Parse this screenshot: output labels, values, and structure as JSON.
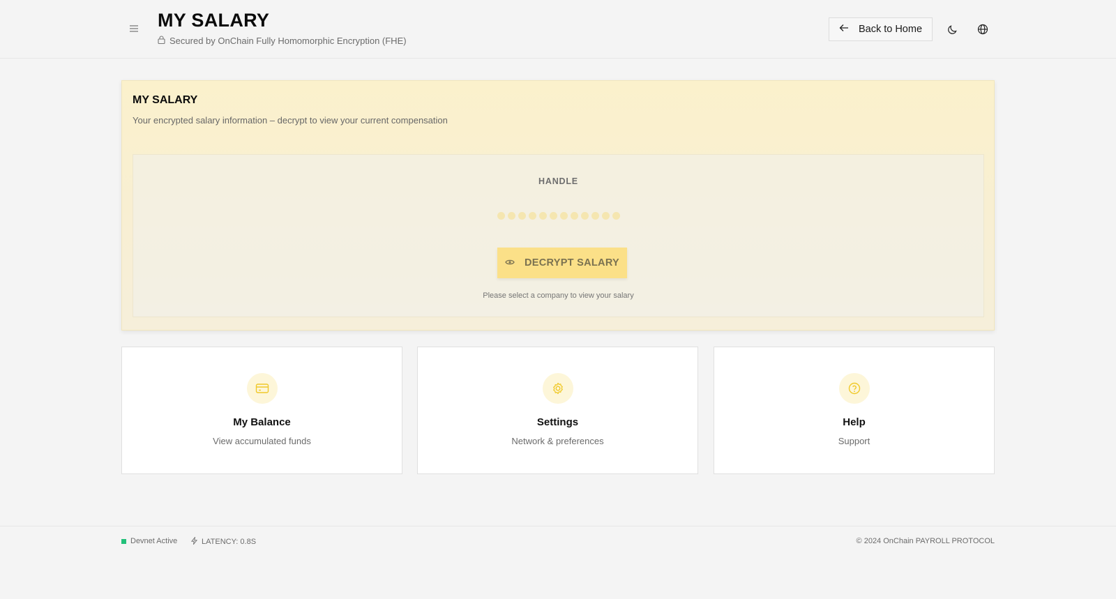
{
  "header": {
    "title": "MY SALARY",
    "subtitle": "Secured by OnChain Fully Homomorphic Encryption (FHE)",
    "back_label": "Back to Home",
    "icons": {
      "menu": "menu-icon",
      "lock": "lock-icon",
      "back": "arrow-left-icon",
      "theme": "moon-icon",
      "language": "globe-icon"
    }
  },
  "salary_card": {
    "title": "MY SALARY",
    "subtitle": "Your encrypted salary information – decrypt to view your current compensation",
    "handle_label": "HANDLE",
    "masked_value": "●●●●●●●●●●●●",
    "decrypt_label": "DECRYPT SALARY",
    "hint": "Please select a company to view your salary"
  },
  "tiles": [
    {
      "title": "My Balance",
      "subtitle": "View accumulated funds",
      "icon": "wallet-icon"
    },
    {
      "title": "Settings",
      "subtitle": "Network & preferences",
      "icon": "gear-icon"
    },
    {
      "title": "Help",
      "subtitle": "Support",
      "icon": "help-icon"
    }
  ],
  "footer": {
    "status": "Devnet Active",
    "latency": "LATENCY: 0.8S",
    "copyright": "© 2024 OnChain PAYROLL PROTOCOL"
  },
  "colors": {
    "accent": "#fbe088",
    "accent_icon": "#f0c92a",
    "status_green": "#22c07a",
    "card_bg": "#fbf1cc"
  }
}
